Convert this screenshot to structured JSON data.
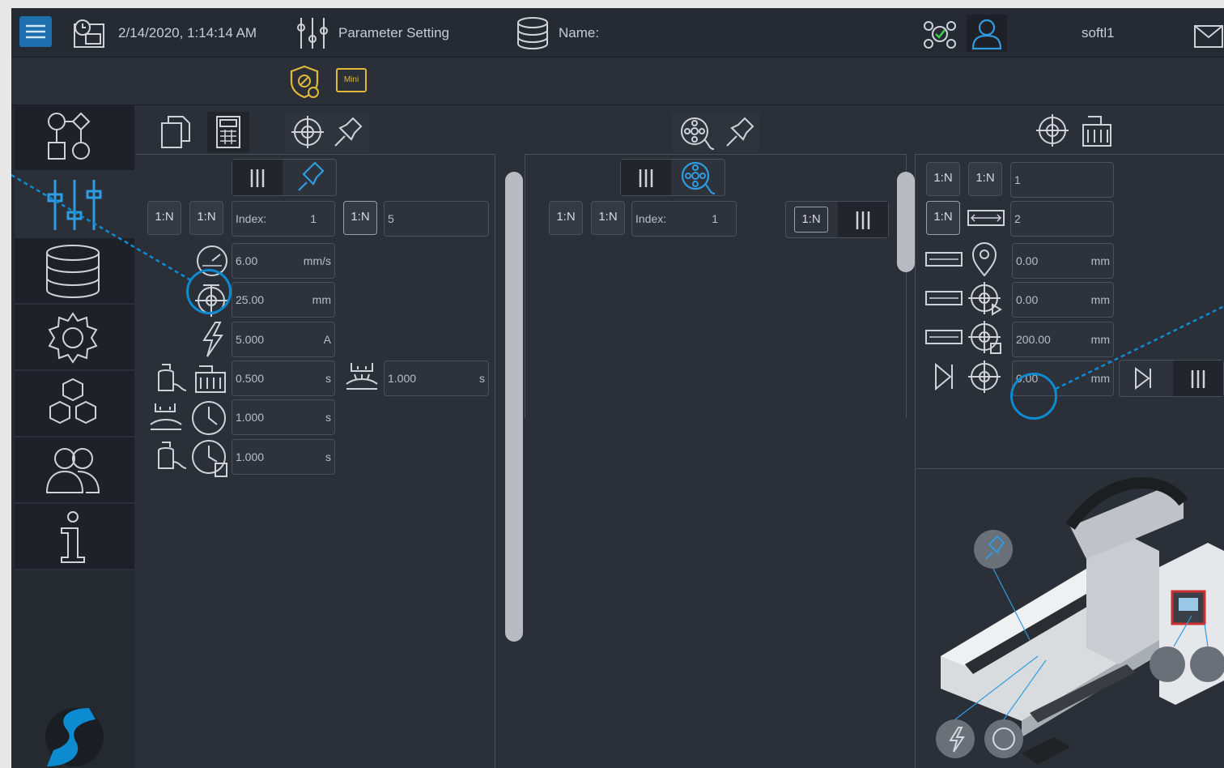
{
  "header": {
    "datetime": "2/14/2020, 1:14:14 AM",
    "mode": "Parameter Setting",
    "name_label": "Name:",
    "user": "softl1"
  },
  "toolbar": {
    "mini_badge": "Mini"
  },
  "left_panel": {
    "index_label": "Index:",
    "index_value": "1",
    "count_label": "1:N",
    "count_value": "5",
    "speed": {
      "value": "6.00",
      "unit": "mm/s"
    },
    "distance": {
      "value": "25.00",
      "unit": "mm"
    },
    "current": {
      "value": "5.000",
      "unit": "A"
    },
    "gas_pre": {
      "value": "0.500",
      "unit": "s"
    },
    "weld_time_2": {
      "value": "1.000",
      "unit": "s"
    },
    "weld_time": {
      "value": "1.000",
      "unit": "s"
    },
    "gas_post": {
      "value": "1.000",
      "unit": "s"
    }
  },
  "middle_panel": {
    "index_label": "Index:",
    "index_value": "1",
    "count_label": "1:N"
  },
  "right_panel": {
    "row1_value": "1",
    "row2_value": "2",
    "rows": [
      {
        "value": "0.00",
        "unit": "mm"
      },
      {
        "value": "0.00",
        "unit": "mm"
      },
      {
        "value": "200.00",
        "unit": "mm"
      },
      {
        "value": "0.00",
        "unit": "mm"
      }
    ],
    "label_1n": "1:N"
  },
  "colors": {
    "accent": "#0d8bd1",
    "background": "#2b3038",
    "sidebar": "#1e2228",
    "badge": "#e0b83a"
  }
}
